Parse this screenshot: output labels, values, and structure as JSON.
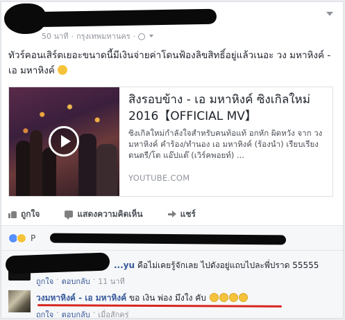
{
  "post": {
    "meta": {
      "time": "50 นาที",
      "location": "กรุงเทพมหานคร"
    },
    "text": "ทัวร์คอนเสิร์ตเยอะขนาดนี้มีเงินจ่ายค่าโดนฟ้องลิขสิทธิ์อยู่แล้วเนอะ วง มหาหิงค์ - เอ มหาหิงค์",
    "icons": {
      "privacy": "globe-icon",
      "emoji": "smile-icon",
      "options": "chevron-down-icon"
    }
  },
  "link_card": {
    "title": "สิงรอบข้าง - เอ มหาหิงค์ ซิงเกิลใหม่ 2016【OFFICIAL MV】",
    "description": "ซิงเกิลใหม่กำลังใจสำหรับคนท้อแท้ อกหัก ผิดหวัง จาก วงมหาหิงค์ คำร้อง/ทำนอง เอ มหาหิงค์ (ร้องนำ) เรียบเรียงดนตรี/โต แอ๊ปแต๊ (เวิร์คพอยท์) ...",
    "source": "YOUTUBE.COM",
    "thumbnail_icon": "play-icon"
  },
  "actions": {
    "like": "ถูกใจ",
    "comment": "แสดงความคิดเห็น",
    "share": "แชร์"
  },
  "reactions": {
    "prefix": "P"
  },
  "comments": [
    {
      "author": "...yu",
      "text": "คือไม่เคยรู้จักเลย ไปดังอยู่แถบไปละพี่ปราด 55555",
      "like": "ถูกใจ",
      "reply": "ตอบกลับ",
      "time": "11 นาที"
    },
    {
      "author": "วงมหาหิงค์ - เอ มหาหิงค์",
      "text": "ขอ เงิน พ่อง มึงใง คับ",
      "like": "ถูกใจ",
      "reply": "ตอบกลับ",
      "time": "เมื่อสักครู่",
      "emoji_count": 4
    }
  ],
  "colors": {
    "link_blue": "#365899",
    "underline_red": "#d6261f",
    "meta_gray": "#90949c"
  }
}
